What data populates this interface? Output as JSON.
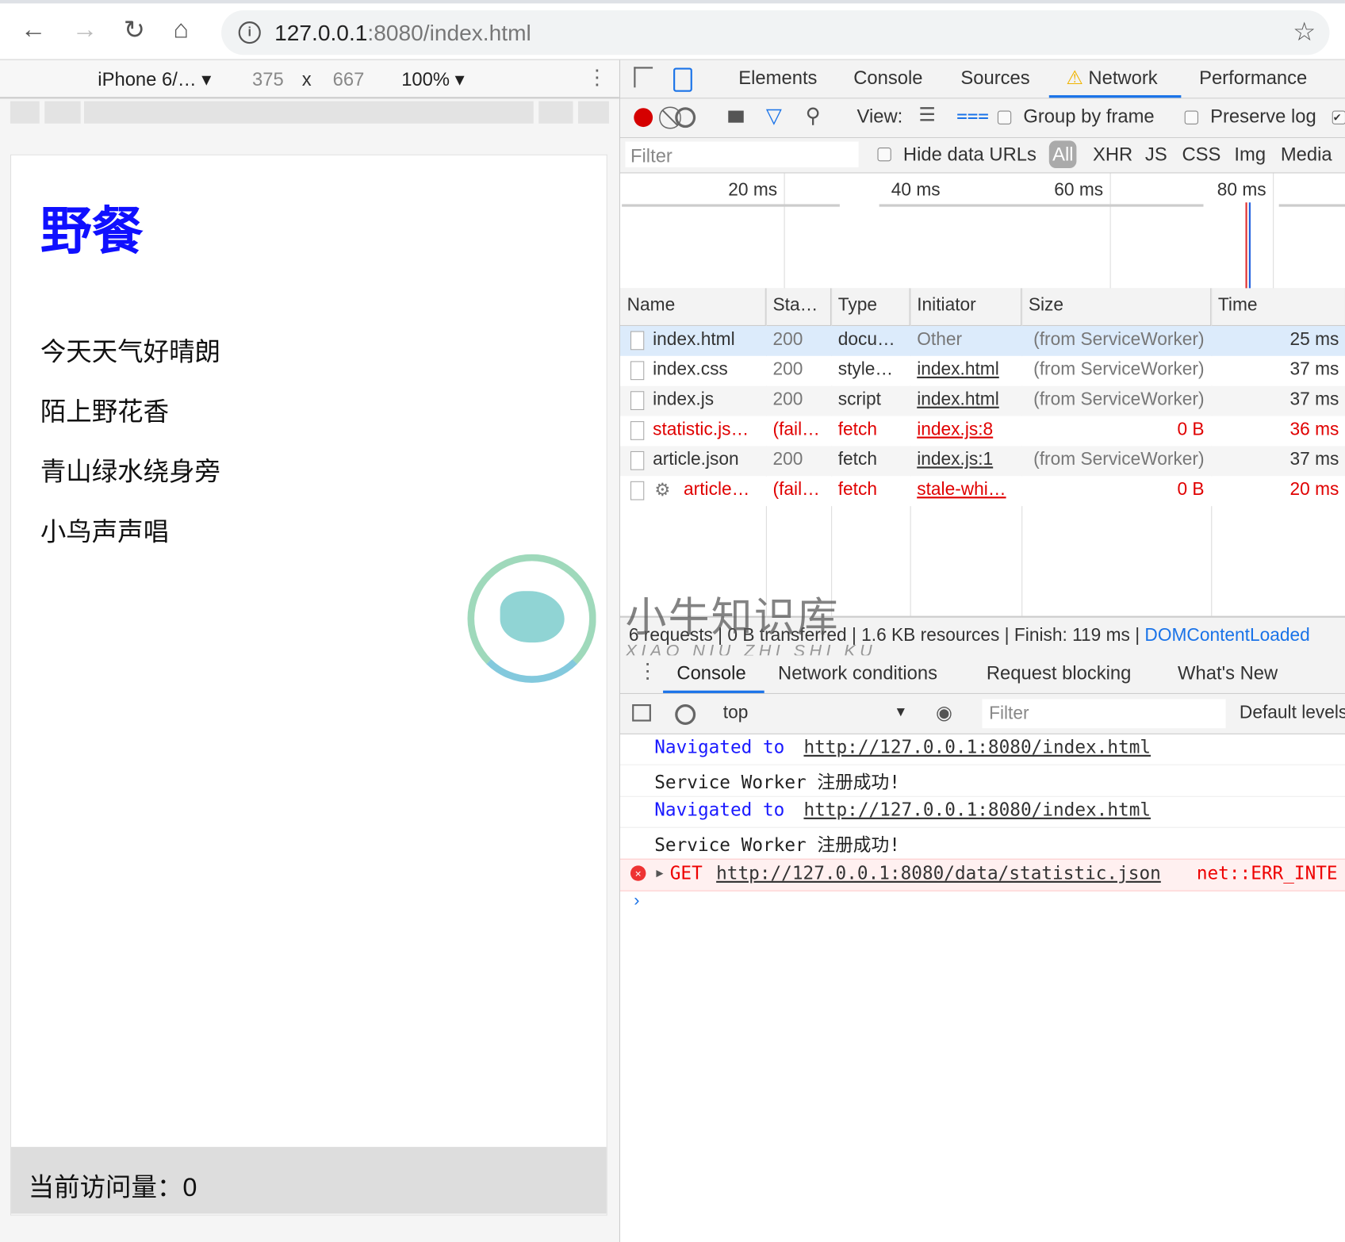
{
  "browser": {
    "url_host": "127.0.0.1",
    "url_rest": ":8080/index.html"
  },
  "device_toolbar": {
    "device": "iPhone 6/…",
    "width": "375",
    "x": "x",
    "height": "667",
    "zoom": "100%"
  },
  "page": {
    "title": "野餐",
    "lines": [
      "今天天气好晴朗",
      "陌上野花香",
      "青山绿水绕身旁",
      "小鸟声声唱"
    ],
    "footer": "当前访问量：0"
  },
  "watermark": {
    "text": "小牛知识库",
    "pinyin": "XIAO NIU ZHI SHI KU"
  },
  "devtools": {
    "tabs": [
      "Elements",
      "Console",
      "Sources",
      "Network",
      "Performance"
    ],
    "active_tab": "Network",
    "toolbar": {
      "view_label": "View:",
      "group_by_frame": "Group by frame",
      "preserve_log": "Preserve log"
    },
    "filter": {
      "placeholder": "Filter",
      "hide_data_urls": "Hide data URLs",
      "types": [
        "All",
        "XHR",
        "JS",
        "CSS",
        "Img",
        "Media"
      ]
    },
    "timeline": {
      "ticks": [
        "20 ms",
        "40 ms",
        "60 ms",
        "80 ms"
      ]
    },
    "columns": [
      "Name",
      "Sta…",
      "Type",
      "Initiator",
      "Size",
      "Time"
    ],
    "rows": [
      {
        "name": "index.html",
        "status": "200",
        "type": "docu…",
        "initiator": "Other",
        "size": "(from ServiceWorker)",
        "time": "25 ms",
        "error": false
      },
      {
        "name": "index.css",
        "status": "200",
        "type": "style…",
        "initiator": "index.html",
        "size": "(from ServiceWorker)",
        "time": "37 ms",
        "error": false
      },
      {
        "name": "index.js",
        "status": "200",
        "type": "script",
        "initiator": "index.html",
        "size": "(from ServiceWorker)",
        "time": "37 ms",
        "error": false
      },
      {
        "name": "statistic.js…",
        "status": "(fail…",
        "type": "fetch",
        "initiator": "index.js:8",
        "size": "0 B",
        "time": "36 ms",
        "error": true
      },
      {
        "name": "article.json",
        "status": "200",
        "type": "fetch",
        "initiator": "index.js:1",
        "size": "(from ServiceWorker)",
        "time": "37 ms",
        "error": false
      },
      {
        "name": "article…",
        "status": "(fail…",
        "type": "fetch",
        "initiator": "stale-whi…",
        "size": "0 B",
        "time": "20 ms",
        "error": true
      }
    ],
    "summary": {
      "text": "6 requests | 0 B transferred | 1.6 KB resources | Finish: 119 ms | ",
      "dcl": "DOMContentLoaded"
    },
    "drawer_tabs": [
      "Console",
      "Network conditions",
      "Request blocking",
      "What's New"
    ],
    "console_toolbar": {
      "context": "top",
      "filter_placeholder": "Filter",
      "levels": "Default levels"
    },
    "console": {
      "nav_prefix": "Navigated to ",
      "nav_url": "http://127.0.0.1:8080/index.html",
      "sw_msg": "Service Worker 注册成功!",
      "err_method": "GET",
      "err_url": "http://127.0.0.1:8080/data/statistic.json",
      "err_code": "net::ERR_INTE"
    }
  },
  "colors": {
    "accent": "#1a73e8",
    "error": "#e00000",
    "title": "#1010ff",
    "selected_row": "#dcebfb"
  }
}
